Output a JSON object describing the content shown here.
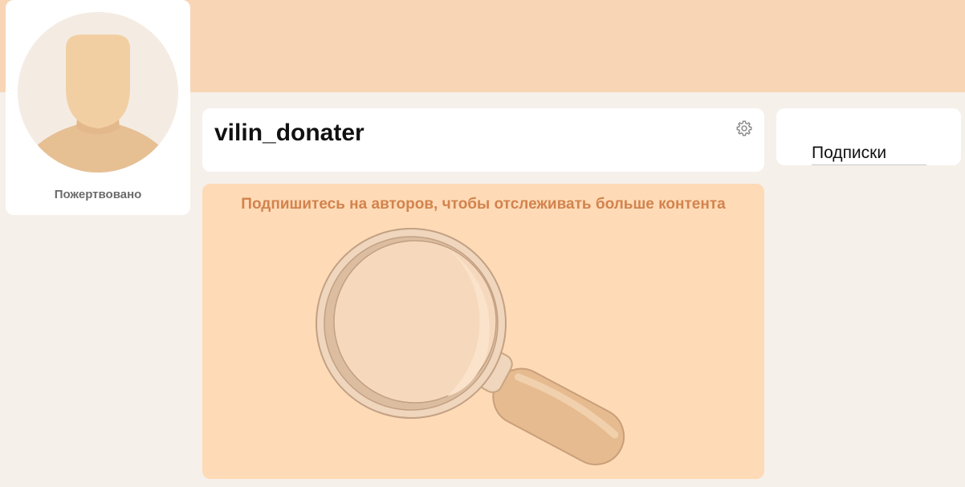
{
  "profile": {
    "donated_label": "Пожертвовано"
  },
  "user": {
    "username": "vilin_donater"
  },
  "subscriptions": {
    "tab_label": "Подписки"
  },
  "empty_state": {
    "message": "Подпишитесь на авторов, чтобы отслеживать больше контента"
  },
  "icons": {
    "settings": "gear-icon",
    "avatar": "default-avatar",
    "illustration": "magnifier-illustration"
  },
  "colors": {
    "banner": "#f8d5b5",
    "background": "#f6f0ea",
    "empty_panel": "#fedbb6",
    "accent_text": "#d2834e"
  }
}
